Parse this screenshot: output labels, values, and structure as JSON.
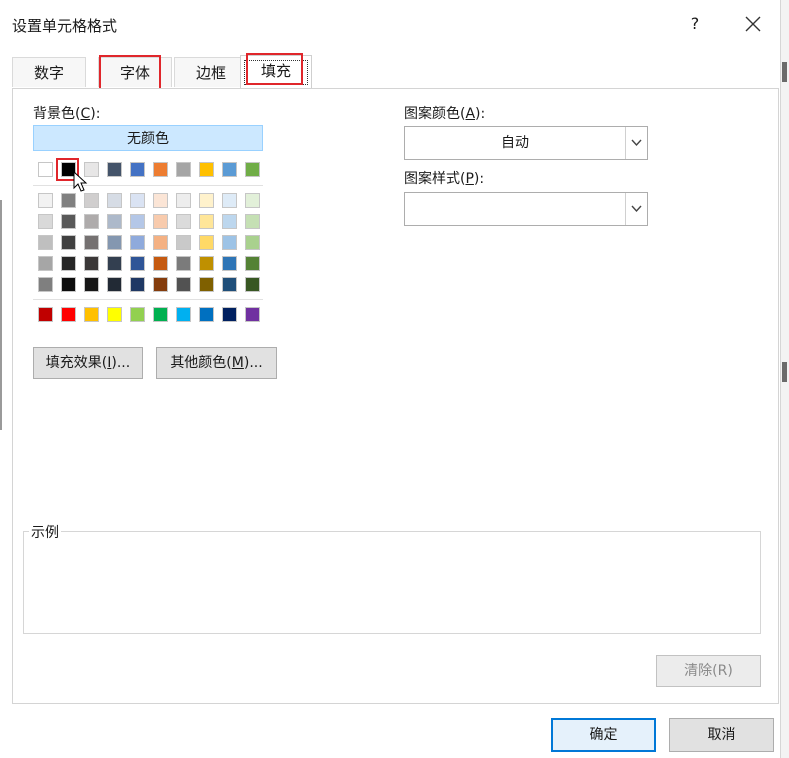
{
  "dialog": {
    "title": "设置单元格格式",
    "help": "?"
  },
  "tabs": [
    {
      "label": "数字"
    },
    {
      "label": "字体"
    },
    {
      "label": "边框"
    },
    {
      "label": "填充"
    }
  ],
  "fill": {
    "background_label": "背景色(",
    "background_key": "C",
    "background_suffix": "):",
    "no_color": "无颜色",
    "theme_top_row": [
      "#ffffff",
      "#000000",
      "#e7e6e6",
      "#44546a",
      "#4472c4",
      "#ed7d31",
      "#a5a5a5",
      "#ffc000",
      "#5b9bd5",
      "#70ad47"
    ],
    "theme_tints": [
      [
        "#f2f2f2",
        "#808080",
        "#d0cece",
        "#d6dce5",
        "#dae3f3",
        "#fbe5d6",
        "#ededed",
        "#fff2cc",
        "#deebf7",
        "#e2f0d9"
      ],
      [
        "#d9d9d9",
        "#595959",
        "#aeabab",
        "#adb9ca",
        "#b4c7e7",
        "#f8cbad",
        "#dbdbdb",
        "#ffe699",
        "#bdd7ee",
        "#c5e0b4"
      ],
      [
        "#bfbfbf",
        "#404040",
        "#757171",
        "#8497b0",
        "#8faadc",
        "#f4b183",
        "#c9c9c9",
        "#ffd966",
        "#9dc3e6",
        "#a9d18e"
      ],
      [
        "#a6a6a6",
        "#262626",
        "#3b3838",
        "#333f50",
        "#2f5597",
        "#c55a11",
        "#7b7b7b",
        "#bf9000",
        "#2e75b6",
        "#548235"
      ],
      [
        "#7f7f7f",
        "#0d0d0d",
        "#171717",
        "#222a35",
        "#1f3864",
        "#843c0c",
        "#525252",
        "#7f6000",
        "#1f4e79",
        "#385723"
      ]
    ],
    "standard_colors": [
      "#c00000",
      "#ff0000",
      "#ffc000",
      "#ffff00",
      "#92d050",
      "#00b050",
      "#00b0f0",
      "#0070c0",
      "#002060",
      "#7030a0"
    ],
    "fill_effects_prefix": "填充效果(",
    "fill_effects_key": "I",
    "fill_effects_suffix": ")...",
    "more_colors_prefix": "其他颜色(",
    "more_colors_key": "M",
    "more_colors_suffix": ")...",
    "pattern_color_prefix": "图案颜色(",
    "pattern_color_key": "A",
    "pattern_color_suffix": "):",
    "pattern_color_value": "自动",
    "pattern_style_prefix": "图案样式(",
    "pattern_style_key": "P",
    "pattern_style_suffix": "):",
    "pattern_style_value": "",
    "sample_label": "示例",
    "clear_button": "清除(R)"
  },
  "footer": {
    "ok": "确定",
    "cancel": "取消"
  },
  "colors": {
    "accent": "#0078d7",
    "highlight": "#e0262b",
    "selected_bg": "#cce8ff"
  }
}
